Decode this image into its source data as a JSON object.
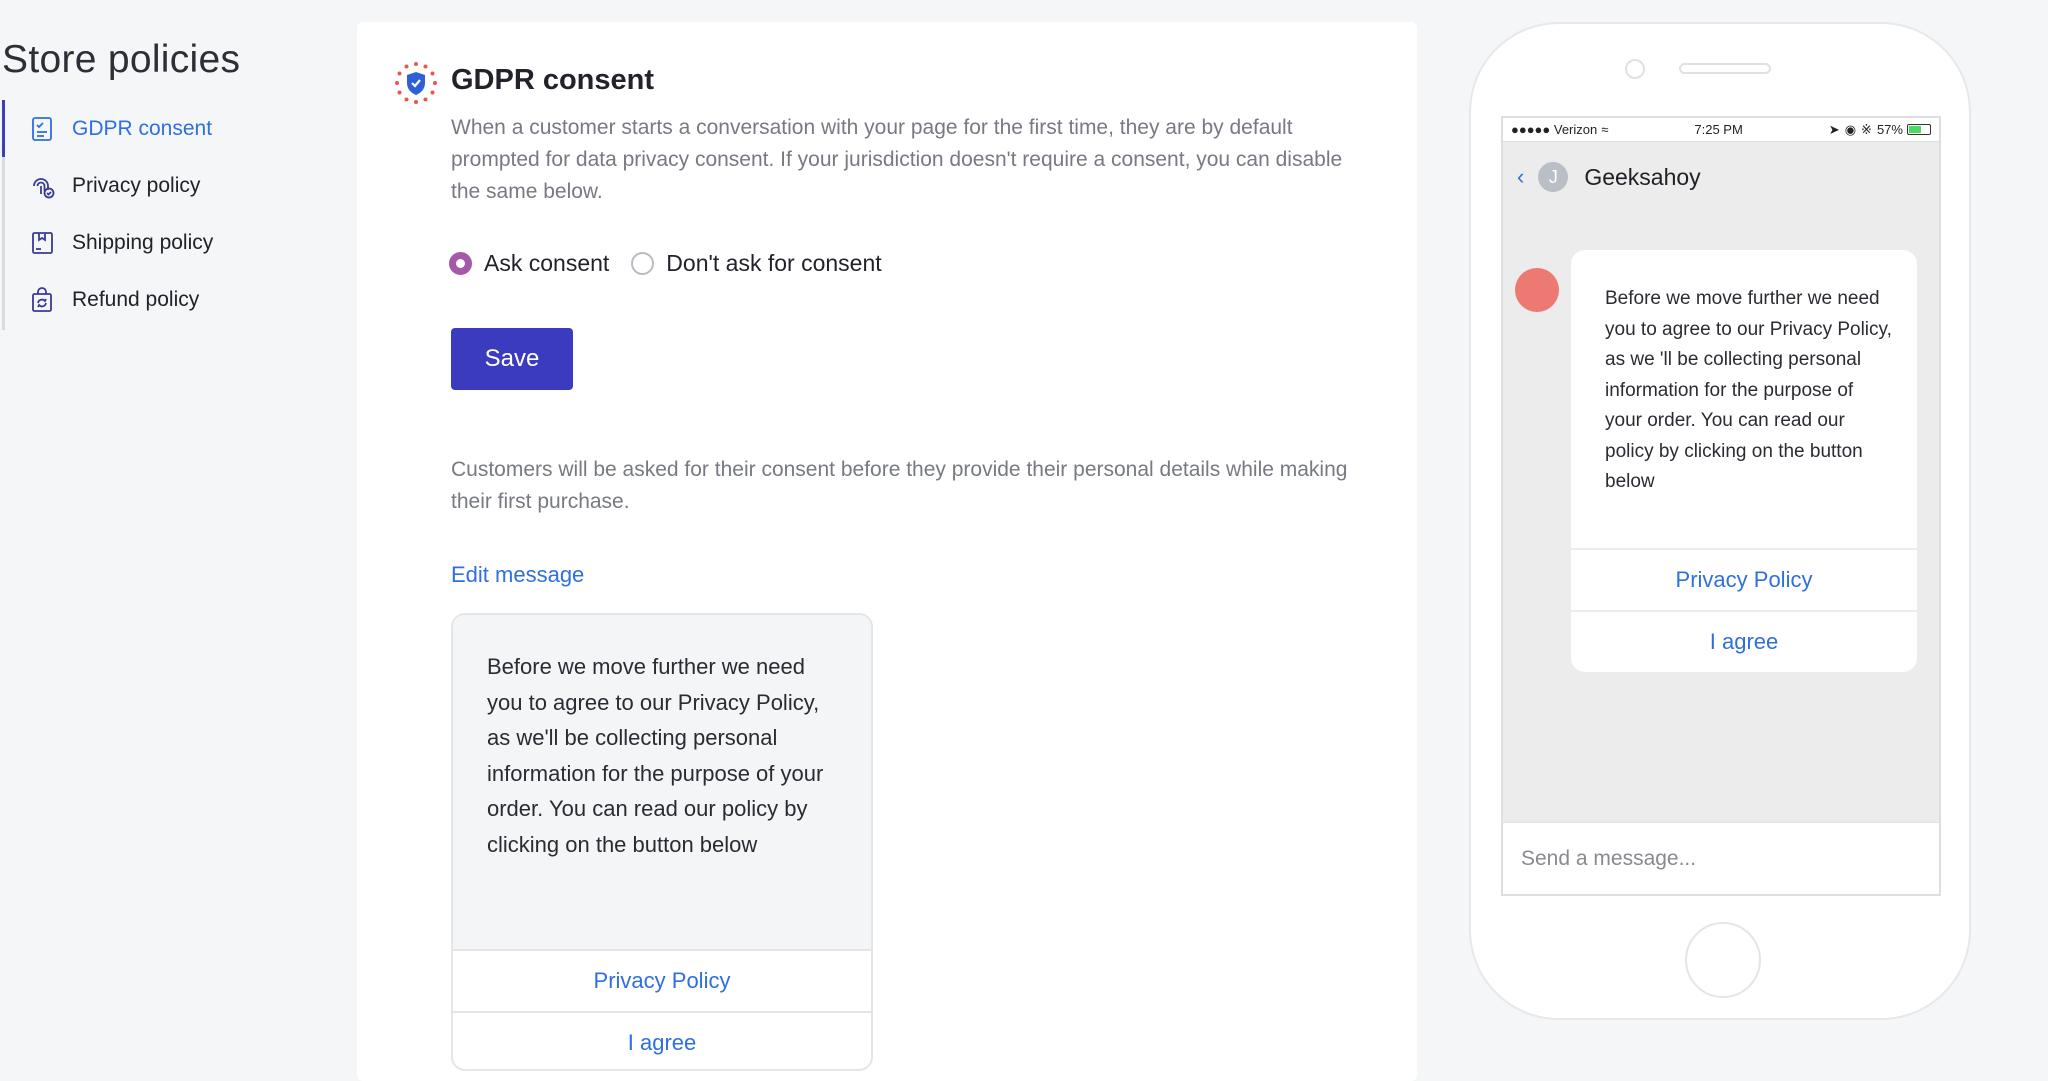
{
  "page": {
    "title": "Store policies"
  },
  "sidebar": {
    "items": [
      {
        "label": "GDPR consent",
        "icon": "checklist-document-icon",
        "active": true
      },
      {
        "label": "Privacy policy",
        "icon": "fingerprint-lock-icon",
        "active": false
      },
      {
        "label": "Shipping policy",
        "icon": "package-icon",
        "active": false
      },
      {
        "label": "Refund policy",
        "icon": "refund-bag-icon",
        "active": false
      }
    ]
  },
  "main": {
    "icon": "eu-shield-icon",
    "title": "GDPR consent",
    "description": "When a customer starts a conversation with your page for the first time, they are by default prompted for data privacy consent. If your jurisdiction doesn't require a consent, you can disable the same below.",
    "radios": [
      {
        "label": "Ask consent",
        "checked": true
      },
      {
        "label": "Don't ask for consent",
        "checked": false
      }
    ],
    "save_label": "Save",
    "note": "Customers will be asked for their consent before they provide their personal details while making their first purchase.",
    "edit_link": "Edit message",
    "message_preview": {
      "text": "Before we move further we need you to agree to our Privacy Policy, as we'll be collecting personal information for the purpose of your order. You can read our policy by clicking on the button below",
      "buttons": [
        "Privacy Policy",
        "I agree"
      ]
    }
  },
  "phone": {
    "status": {
      "carrier": "●●●●● Verizon",
      "time": "7:25 PM",
      "battery": "57%"
    },
    "chat_title": "Geeksahoy",
    "avatar_letter": "J",
    "bubble_text": "Before we move further we need you to agree to our Privacy Policy, as we 'll be collecting personal information for the purpose of your order. You can read our policy by clicking on the button below",
    "bubble_buttons": [
      "Privacy Policy",
      "I agree"
    ],
    "composer_placeholder": "Send a message..."
  },
  "colors": {
    "accent": "#3a3bbf",
    "link": "#2f6fde",
    "radio_checked": "#a45aa8",
    "bot_avatar": "#ec7a73"
  }
}
